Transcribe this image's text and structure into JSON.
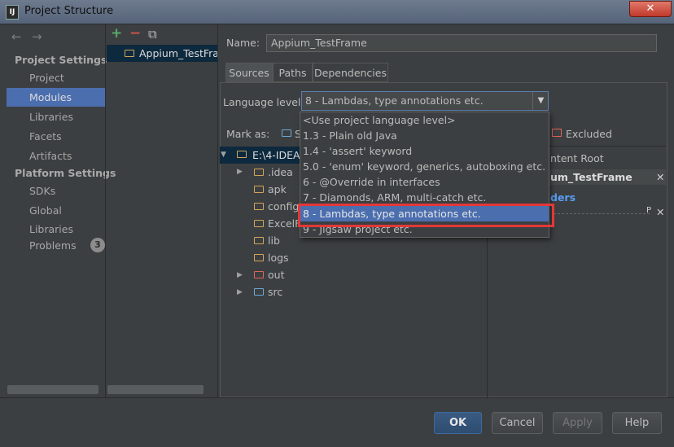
{
  "window": {
    "title": "Project Structure",
    "close_glyph": "✕",
    "icon_text": "IJ"
  },
  "nav": {
    "back_icon": "←",
    "forward_icon": "→",
    "project_settings": "Project Settings",
    "platform_settings": "Platform Settings",
    "items": [
      {
        "label": "Project"
      },
      {
        "label": "Modules"
      },
      {
        "label": "Libraries"
      },
      {
        "label": "Facets"
      },
      {
        "label": "Artifacts"
      }
    ],
    "platform_items": [
      {
        "label": "SDKs"
      },
      {
        "label": "Global Libraries"
      }
    ],
    "problems": {
      "label": "Problems",
      "count": "3"
    }
  },
  "module_list": {
    "add_icon": "+",
    "remove_icon": "−",
    "copy_icon": "⧉",
    "module": "Appium_TestFrame"
  },
  "module": {
    "name_label": "Name:",
    "name_value": "Appium_TestFrame",
    "tabs": [
      {
        "label": "Sources"
      },
      {
        "label": "Paths"
      },
      {
        "label": "Dependencies"
      }
    ],
    "language_level_label": "Language level:",
    "language_level_value": "8 - Lambdas, type annotations etc.",
    "dropdown_arrow": "▼",
    "mark_as_label": "Mark as:",
    "mark_as_sources": "S",
    "excluded_label": "Excluded",
    "content_root_label": "ntent Root",
    "content_root_name": "um_TestFrame",
    "content_root_close": "✕",
    "folders_label": "ders",
    "folders_icon": "P",
    "folders_close": "✕"
  },
  "tree": {
    "root": "E:\\4-IDEA\\",
    "expanded_glyph": "▼",
    "collapsed_glyph": "▶",
    "children": [
      {
        "label": ".idea"
      },
      {
        "label": "apk"
      },
      {
        "label": "config"
      },
      {
        "label": "ExcelF"
      },
      {
        "label": "lib"
      },
      {
        "label": "logs"
      },
      {
        "label": "out"
      },
      {
        "label": "src"
      }
    ]
  },
  "dropdown": {
    "options": [
      {
        "label": "<Use project language level>"
      },
      {
        "label": "1.3 - Plain old Java"
      },
      {
        "label": "1.4 - 'assert' keyword"
      },
      {
        "label": "5.0 - 'enum' keyword, generics, autoboxing etc."
      },
      {
        "label": "6 - @Override in interfaces"
      },
      {
        "label": "7 - Diamonds, ARM, multi-catch etc."
      },
      {
        "label": "8 - Lambdas, type annotations etc."
      },
      {
        "label": "9 - Jigsaw project etc."
      }
    ],
    "selected_index": 6
  },
  "footer": {
    "ok": "OK",
    "cancel": "Cancel",
    "apply": "Apply",
    "help": "Help"
  },
  "colors": {
    "accent": "#4b6eaf",
    "background": "#3c3f41",
    "highlight_border": "#e33838",
    "add_green": "#59a869",
    "remove_red": "#c75450"
  }
}
